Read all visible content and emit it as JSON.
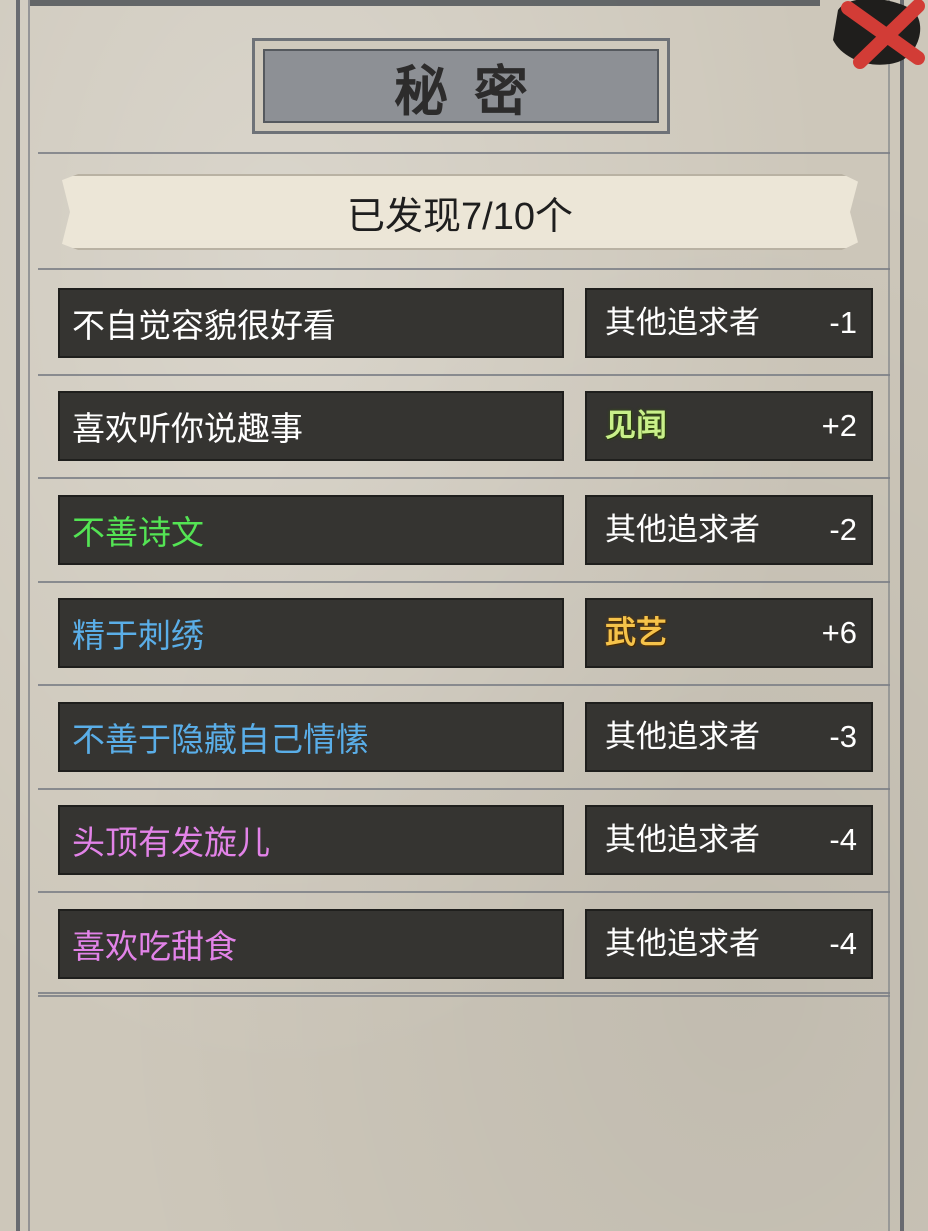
{
  "title": "秘密",
  "summary": "已发现7/10个",
  "colors": {
    "white": "#ffffff",
    "green": "#54e454",
    "blue": "#5aaee8",
    "pink": "#e283e8"
  },
  "secrets": [
    {
      "trait": "不自觉容貌很好看",
      "trait_color": "#ffffff",
      "effect": "其他追求者",
      "effect_style": "plain",
      "value": "-1"
    },
    {
      "trait": "喜欢听你说趣事",
      "trait_color": "#ffffff",
      "effect": "见闻",
      "effect_style": "jianwen",
      "value": "+2"
    },
    {
      "trait": "不善诗文",
      "trait_color": "#54e454",
      "effect": "其他追求者",
      "effect_style": "plain",
      "value": "-2"
    },
    {
      "trait": "精于刺绣",
      "trait_color": "#5aaee8",
      "effect": "武艺",
      "effect_style": "wuyi",
      "value": "+6"
    },
    {
      "trait": "不善于隐藏自己情愫",
      "trait_color": "#5aaee8",
      "effect": "其他追求者",
      "effect_style": "plain",
      "value": "-3"
    },
    {
      "trait": "头顶有发旋儿",
      "trait_color": "#e283e8",
      "effect": "其他追求者",
      "effect_style": "plain",
      "value": "-4"
    },
    {
      "trait": "喜欢吃甜食",
      "trait_color": "#e283e8",
      "effect": "其他追求者",
      "effect_style": "plain",
      "value": "-4"
    }
  ],
  "icons": {
    "close": "close-x-icon"
  }
}
